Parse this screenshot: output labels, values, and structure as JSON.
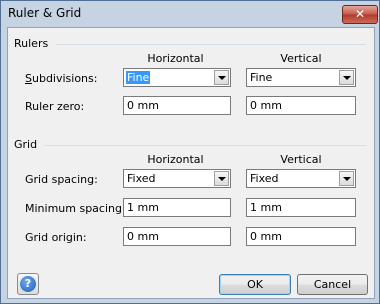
{
  "window": {
    "title": "Ruler & Grid",
    "close_glyph": "✕"
  },
  "rulers": {
    "section_label": "Rulers",
    "col_horizontal": "Horizontal",
    "col_vertical": "Vertical",
    "subdivisions_label": "Subdivisions:",
    "subdivisions_h": "Fine",
    "subdivisions_v": "Fine",
    "ruler_zero_label": "Ruler zero:",
    "ruler_zero_h": "0 mm",
    "ruler_zero_v": "0 mm"
  },
  "grid": {
    "section_label": "Grid",
    "col_horizontal": "Horizontal",
    "col_vertical": "Vertical",
    "grid_spacing_label": "Grid spacing:",
    "grid_spacing_h": "Fixed",
    "grid_spacing_v": "Fixed",
    "min_spacing_label": "Minimum spacing:",
    "min_spacing_h": "1 mm",
    "min_spacing_v": "1 mm",
    "grid_origin_label": "Grid origin:",
    "grid_origin_h": "0 mm",
    "grid_origin_v": "0 mm"
  },
  "buttons": {
    "help": "?",
    "ok": "OK",
    "cancel": "Cancel"
  }
}
